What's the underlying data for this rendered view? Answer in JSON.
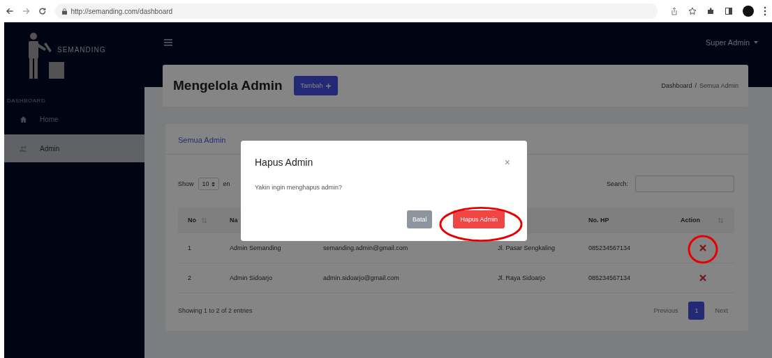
{
  "browser": {
    "url": "http://semanding.com/dashboard"
  },
  "brand": "SEMANDING",
  "sidebar": {
    "heading": "DASHBOARD",
    "items": [
      {
        "label": "Home",
        "selected": false
      },
      {
        "label": "Admin",
        "selected": true
      }
    ]
  },
  "user_menu": "Super Admin",
  "page": {
    "title": "Mengelola Admin",
    "add_button": "Tambah",
    "breadcrumb": [
      "Dashboard",
      "Semua Admin"
    ],
    "breadcrumb_separator": "/"
  },
  "card": {
    "title": "Semua Admin",
    "length_label": "Show",
    "length_value": "10",
    "length_suffix": "en",
    "search_label": "Search:",
    "columns": [
      {
        "label": "No",
        "sortable": true
      },
      {
        "label": "Na"
      },
      {},
      {},
      {
        "label": "No. HP"
      },
      {
        "label": "Action",
        "sortable": true
      }
    ],
    "rows": [
      {
        "no": "1",
        "name": "Admin Semanding",
        "email": "semanding.admin@gmail.com",
        "address": "Jl. Pasar Sengkaling",
        "phone": "085234567134"
      },
      {
        "no": "2",
        "name": "Admin Sidoarjo",
        "email": "admin.sidoarjo@gmail.com",
        "address": "Jl. Raya Sidoarjo",
        "phone": "085234567134"
      }
    ],
    "info": "Showing 1 to 2 of 2 entries",
    "pagination": [
      {
        "label": "Previous",
        "selected": false
      },
      {
        "label": "1",
        "selected": true
      },
      {
        "label": "Next",
        "selected": false
      }
    ]
  },
  "modal": {
    "title": "Hapus Admin",
    "close": "×",
    "message": "Yakin ingin menghapus admin?",
    "buttons": [
      {
        "label": "Batal",
        "kind": "secondary"
      },
      {
        "label": "Hapus Admin",
        "kind": "danger"
      }
    ]
  }
}
